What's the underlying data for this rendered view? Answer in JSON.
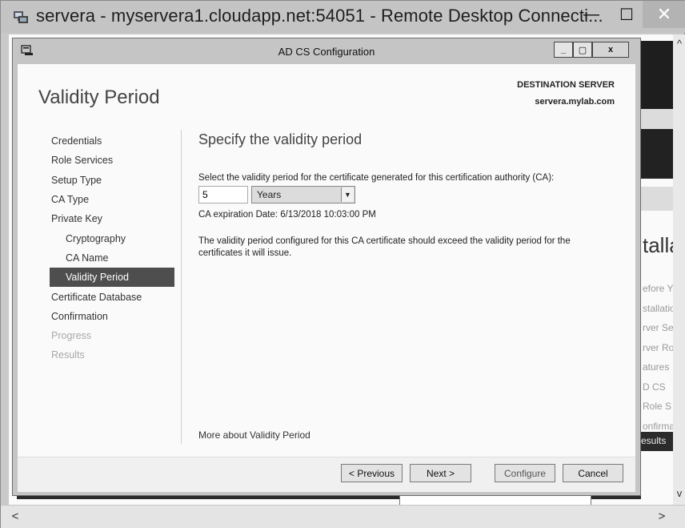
{
  "rdp": {
    "title": "servera - myservera1.cloudapp.net:54051 - Remote Desktop Connecti...",
    "minimize_glyph": "—",
    "maximize_glyph": "☐",
    "close_glyph": "✕"
  },
  "dialog": {
    "title": "AD CS Configuration",
    "minimize_glyph": "_",
    "maximize_glyph": "▢",
    "close_glyph": "x"
  },
  "header": {
    "page_title": "Validity Period",
    "destination_label": "DESTINATION SERVER",
    "destination_value": "servera.mylab.com"
  },
  "nav": {
    "items": [
      {
        "label": "Credentials",
        "state": "normal"
      },
      {
        "label": "Role Services",
        "state": "normal"
      },
      {
        "label": "Setup Type",
        "state": "normal"
      },
      {
        "label": "CA Type",
        "state": "normal"
      },
      {
        "label": "Private Key",
        "state": "normal"
      },
      {
        "label": "Cryptography",
        "state": "sub"
      },
      {
        "label": "CA Name",
        "state": "sub"
      },
      {
        "label": "Validity Period",
        "state": "active"
      },
      {
        "label": "Certificate Database",
        "state": "normal"
      },
      {
        "label": "Confirmation",
        "state": "normal"
      },
      {
        "label": "Progress",
        "state": "disabled"
      },
      {
        "label": "Results",
        "state": "disabled"
      }
    ]
  },
  "content": {
    "heading": "Specify the validity period",
    "prompt": "Select the validity period for the certificate generated for this certification authority (CA):",
    "period_value": "5",
    "period_unit": "Years",
    "expiry": "CA expiration Date: 6/13/2018 10:03:00 PM",
    "note": "The validity period configured for this CA certificate should exceed the validity period for the certificates it will issue.",
    "more_link": "More about Validity Period"
  },
  "buttons": {
    "previous": "< Previous",
    "next": "Next >",
    "configure": "Configure",
    "cancel": "Cancel"
  },
  "background": {
    "title_fragment": "talla",
    "list_fragments": [
      "efore Yo",
      "stallatio",
      "rver Se",
      "rver Ro",
      "atures",
      "D CS",
      "Role S",
      "onfirma"
    ],
    "selected_fragment": "esults"
  },
  "scroll": {
    "up": "^",
    "down": "v",
    "left": "<",
    "right": ">"
  }
}
